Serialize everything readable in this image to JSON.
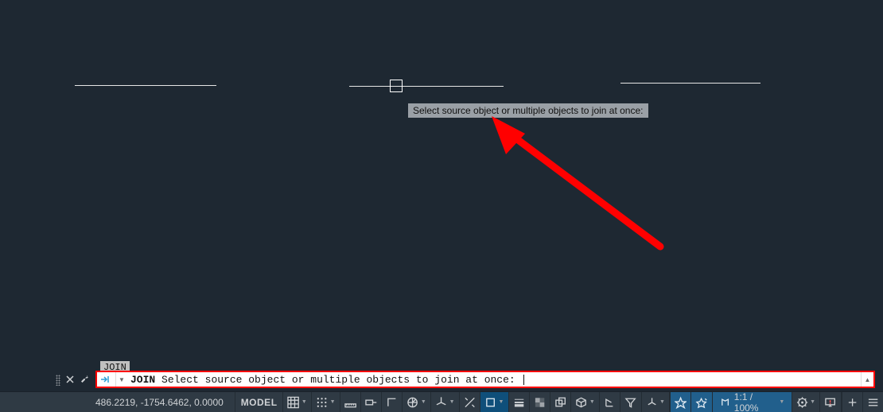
{
  "canvas": {
    "tooltip": "Select source object or multiple objects to join at once:"
  },
  "command": {
    "history_label": "JOIN",
    "name": "JOIN",
    "prompt": "Select source object or multiple objects to join at once: "
  },
  "status": {
    "coords": "486.2219, -1754.6462, 0.0000",
    "space_label": "MODEL",
    "scale_label": "1:1 / 100%"
  },
  "icons": {
    "close": "close-icon",
    "wrench": "wrench-icon",
    "cmd_prefix": "command-prompt-icon",
    "dropdown": "chevron-down-icon",
    "scroll_up": "chevron-up-icon"
  }
}
